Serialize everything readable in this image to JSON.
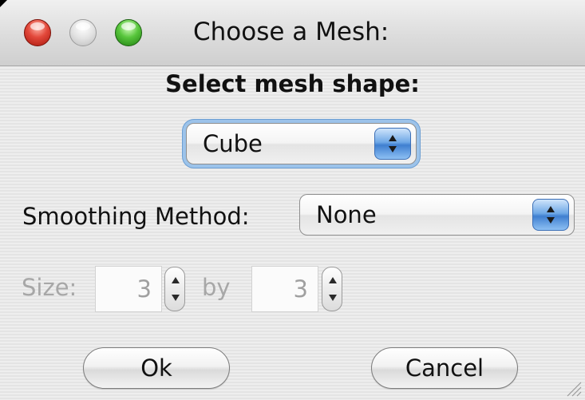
{
  "window": {
    "title": "Choose a Mesh:"
  },
  "heading": "Select mesh shape:",
  "mesh_shape": {
    "selected": "Cube"
  },
  "smoothing": {
    "label": "Smoothing Method:",
    "selected": "None"
  },
  "size": {
    "label": "Size:",
    "width_value": "3",
    "by_label": "by",
    "height_value": "3"
  },
  "buttons": {
    "ok": "Ok",
    "cancel": "Cancel"
  },
  "icons": {
    "close": "close-icon",
    "minimize": "minimize-icon",
    "zoom": "zoom-icon",
    "popup_arrows": "chevron-up-down-icon",
    "resize": "resize-grip-icon"
  },
  "colors": {
    "accent": "#3f7fd0",
    "focus_ring": "#9cc3ea",
    "close": "#e2483a",
    "zoom": "#58c63c",
    "disabled_text": "#a7a7a7"
  }
}
